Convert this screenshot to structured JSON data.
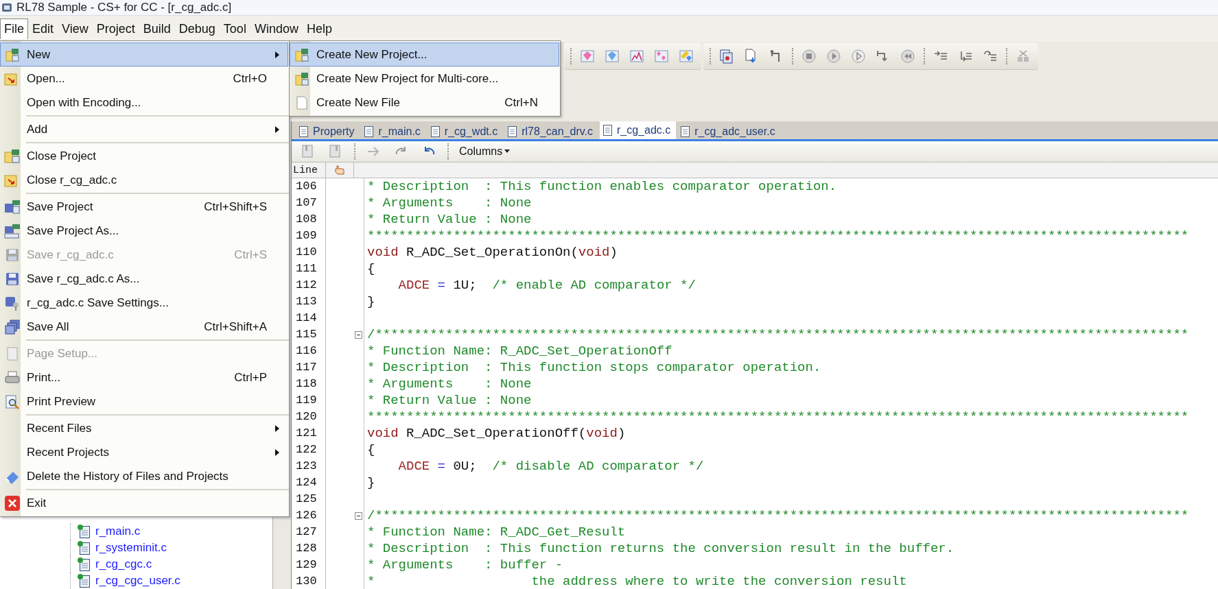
{
  "window": {
    "title": "RL78 Sample - CS+ for CC - [r_cg_adc.c]"
  },
  "menu_bar": [
    {
      "label": "File",
      "selected": true
    },
    {
      "label": "Edit",
      "selected": false
    },
    {
      "label": "View",
      "selected": false
    },
    {
      "label": "Project",
      "selected": false
    },
    {
      "label": "Build",
      "selected": false
    },
    {
      "label": "Debug",
      "selected": false
    },
    {
      "label": "Tool",
      "selected": false
    },
    {
      "label": "Window",
      "selected": false
    },
    {
      "label": "Help",
      "selected": false
    }
  ],
  "file_menu": [
    {
      "kind": "item",
      "label": "New",
      "submenu": true,
      "disabled": false,
      "selected": true
    },
    {
      "kind": "item",
      "label": "Open...",
      "shortcut": "Ctrl+O",
      "submenu": false,
      "disabled": false,
      "selected": false
    },
    {
      "kind": "item",
      "label": "Open with Encoding...",
      "submenu": false,
      "disabled": false,
      "selected": false
    },
    {
      "kind": "separator"
    },
    {
      "kind": "item",
      "label": "Add",
      "submenu": true,
      "disabled": false,
      "selected": false
    },
    {
      "kind": "separator"
    },
    {
      "kind": "item",
      "label": "Close Project",
      "submenu": false,
      "disabled": false,
      "selected": false
    },
    {
      "kind": "item",
      "label": "Close r_cg_adc.c",
      "submenu": false,
      "disabled": false,
      "selected": false
    },
    {
      "kind": "separator"
    },
    {
      "kind": "item",
      "label": "Save Project",
      "shortcut": "Ctrl+Shift+S",
      "submenu": false,
      "disabled": false,
      "selected": false
    },
    {
      "kind": "item",
      "label": "Save Project As...",
      "submenu": false,
      "disabled": false,
      "selected": false
    },
    {
      "kind": "item",
      "label": "Save r_cg_adc.c",
      "shortcut": "Ctrl+S",
      "submenu": false,
      "disabled": true,
      "selected": false
    },
    {
      "kind": "item",
      "label": "Save r_cg_adc.c As...",
      "submenu": false,
      "disabled": false,
      "selected": false
    },
    {
      "kind": "item",
      "label": "r_cg_adc.c Save Settings...",
      "submenu": false,
      "disabled": false,
      "selected": false
    },
    {
      "kind": "item",
      "label": "Save All",
      "shortcut": "Ctrl+Shift+A",
      "submenu": false,
      "disabled": false,
      "selected": false
    },
    {
      "kind": "separator"
    },
    {
      "kind": "item",
      "label": "Page Setup...",
      "submenu": false,
      "disabled": true,
      "selected": false
    },
    {
      "kind": "item",
      "label": "Print...",
      "shortcut": "Ctrl+P",
      "submenu": false,
      "disabled": false,
      "selected": false
    },
    {
      "kind": "item",
      "label": "Print Preview",
      "submenu": false,
      "disabled": false,
      "selected": false
    },
    {
      "kind": "separator"
    },
    {
      "kind": "item",
      "label": "Recent Files",
      "submenu": true,
      "disabled": false,
      "selected": false
    },
    {
      "kind": "item",
      "label": "Recent Projects",
      "submenu": true,
      "disabled": false,
      "selected": false
    },
    {
      "kind": "item",
      "label": "Delete the History of Files and Projects",
      "submenu": false,
      "disabled": false,
      "selected": false
    },
    {
      "kind": "separator"
    },
    {
      "kind": "item",
      "label": "Exit",
      "submenu": false,
      "disabled": false,
      "selected": false
    }
  ],
  "new_submenu": [
    {
      "label": "Create New Project...",
      "selected": true
    },
    {
      "label": "Create New Project for Multi-core...",
      "selected": false
    },
    {
      "label": "Create New File",
      "shortcut": "Ctrl+N",
      "selected": false
    }
  ],
  "editor_tabs": [
    {
      "label": "Property",
      "selected": false
    },
    {
      "label": "r_main.c",
      "selected": false
    },
    {
      "label": "r_cg_wdt.c",
      "selected": false
    },
    {
      "label": "rl78_can_drv.c",
      "selected": false
    },
    {
      "label": "r_cg_adc.c",
      "selected": true
    },
    {
      "label": "r_cg_adc_user.c",
      "selected": false
    }
  ],
  "editor_toolbar": {
    "columns_button": "Columns"
  },
  "code_view": {
    "header": "Line",
    "lines": [
      {
        "number": "106",
        "collapsible": false,
        "tokens": [
          {
            "kind": "comment",
            "text": "* Description  : This function enables comparator operation."
          }
        ]
      },
      {
        "number": "107",
        "collapsible": false,
        "tokens": [
          {
            "kind": "comment",
            "text": "* Arguments    : None"
          }
        ]
      },
      {
        "number": "108",
        "collapsible": false,
        "tokens": [
          {
            "kind": "comment",
            "text": "* Return Value : None"
          }
        ]
      },
      {
        "number": "109",
        "collapsible": false,
        "tokens": [
          {
            "kind": "comment",
            "text": "*********************************************************************************************************"
          }
        ]
      },
      {
        "number": "110",
        "collapsible": false,
        "tokens": [
          {
            "kind": "keyword",
            "text": "void"
          },
          {
            "kind": "plain",
            "text": " R_ADC_Set_OperationOn("
          },
          {
            "kind": "keyword",
            "text": "void"
          },
          {
            "kind": "plain",
            "text": ")"
          }
        ]
      },
      {
        "number": "111",
        "collapsible": false,
        "tokens": [
          {
            "kind": "plain",
            "text": "{"
          }
        ]
      },
      {
        "number": "112",
        "collapsible": false,
        "indented": true,
        "tokens": [
          {
            "kind": "variable",
            "text": "ADCE"
          },
          {
            "kind": "operator",
            "text": " ="
          },
          {
            "kind": "plain",
            "text": " 1U;  "
          },
          {
            "kind": "comment",
            "text": "/* enable AD comparator */"
          }
        ]
      },
      {
        "number": "113",
        "collapsible": false,
        "tokens": [
          {
            "kind": "plain",
            "text": "}"
          }
        ]
      },
      {
        "number": "114",
        "collapsible": false
      },
      {
        "number": "115",
        "collapsible": true,
        "tokens": [
          {
            "kind": "comment",
            "text": "/********************************************************************************************************"
          }
        ]
      },
      {
        "number": "116",
        "collapsible": false,
        "tokens": [
          {
            "kind": "comment",
            "text": "* Function Name: R_ADC_Set_OperationOff"
          }
        ]
      },
      {
        "number": "117",
        "collapsible": false,
        "tokens": [
          {
            "kind": "comment",
            "text": "* Description  : This function stops comparator operation."
          }
        ]
      },
      {
        "number": "118",
        "collapsible": false,
        "tokens": [
          {
            "kind": "comment",
            "text": "* Arguments    : None"
          }
        ]
      },
      {
        "number": "119",
        "collapsible": false,
        "tokens": [
          {
            "kind": "comment",
            "text": "* Return Value : None"
          }
        ]
      },
      {
        "number": "120",
        "collapsible": false,
        "tokens": [
          {
            "kind": "comment",
            "text": "*********************************************************************************************************"
          }
        ]
      },
      {
        "number": "121",
        "collapsible": false,
        "tokens": [
          {
            "kind": "keyword",
            "text": "void"
          },
          {
            "kind": "plain",
            "text": " R_ADC_Set_OperationOff("
          },
          {
            "kind": "keyword",
            "text": "void"
          },
          {
            "kind": "plain",
            "text": ")"
          }
        ]
      },
      {
        "number": "122",
        "collapsible": false,
        "tokens": [
          {
            "kind": "plain",
            "text": "{"
          }
        ]
      },
      {
        "number": "123",
        "collapsible": false,
        "indented": true,
        "tokens": [
          {
            "kind": "variable",
            "text": "ADCE"
          },
          {
            "kind": "operator",
            "text": " ="
          },
          {
            "kind": "plain",
            "text": " 0U;  "
          },
          {
            "kind": "comment",
            "text": "/* disable AD comparator */"
          }
        ]
      },
      {
        "number": "124",
        "collapsible": false,
        "tokens": [
          {
            "kind": "plain",
            "text": "}"
          }
        ]
      },
      {
        "number": "125",
        "collapsible": false
      },
      {
        "number": "126",
        "collapsible": true,
        "tokens": [
          {
            "kind": "comment",
            "text": "/********************************************************************************************************"
          }
        ]
      },
      {
        "number": "127",
        "collapsible": false,
        "tokens": [
          {
            "kind": "comment",
            "text": "* Function Name: R_ADC_Get_Result"
          }
        ]
      },
      {
        "number": "128",
        "collapsible": false,
        "tokens": [
          {
            "kind": "comment",
            "text": "* Description  : This function returns the conversion result in the buffer."
          }
        ]
      },
      {
        "number": "129",
        "collapsible": false,
        "tokens": [
          {
            "kind": "comment",
            "text": "* Arguments    : buffer -"
          }
        ]
      },
      {
        "number": "130",
        "collapsible": false,
        "tokens": [
          {
            "kind": "comment",
            "text": "*                    the address where to write the conversion result"
          }
        ]
      }
    ]
  },
  "project_tree": {
    "items": [
      {
        "label": "r_main.c"
      },
      {
        "label": "r_systeminit.c"
      },
      {
        "label": "r_cg_cgc.c"
      },
      {
        "label": "r_cg_cgc_user.c"
      }
    ]
  }
}
